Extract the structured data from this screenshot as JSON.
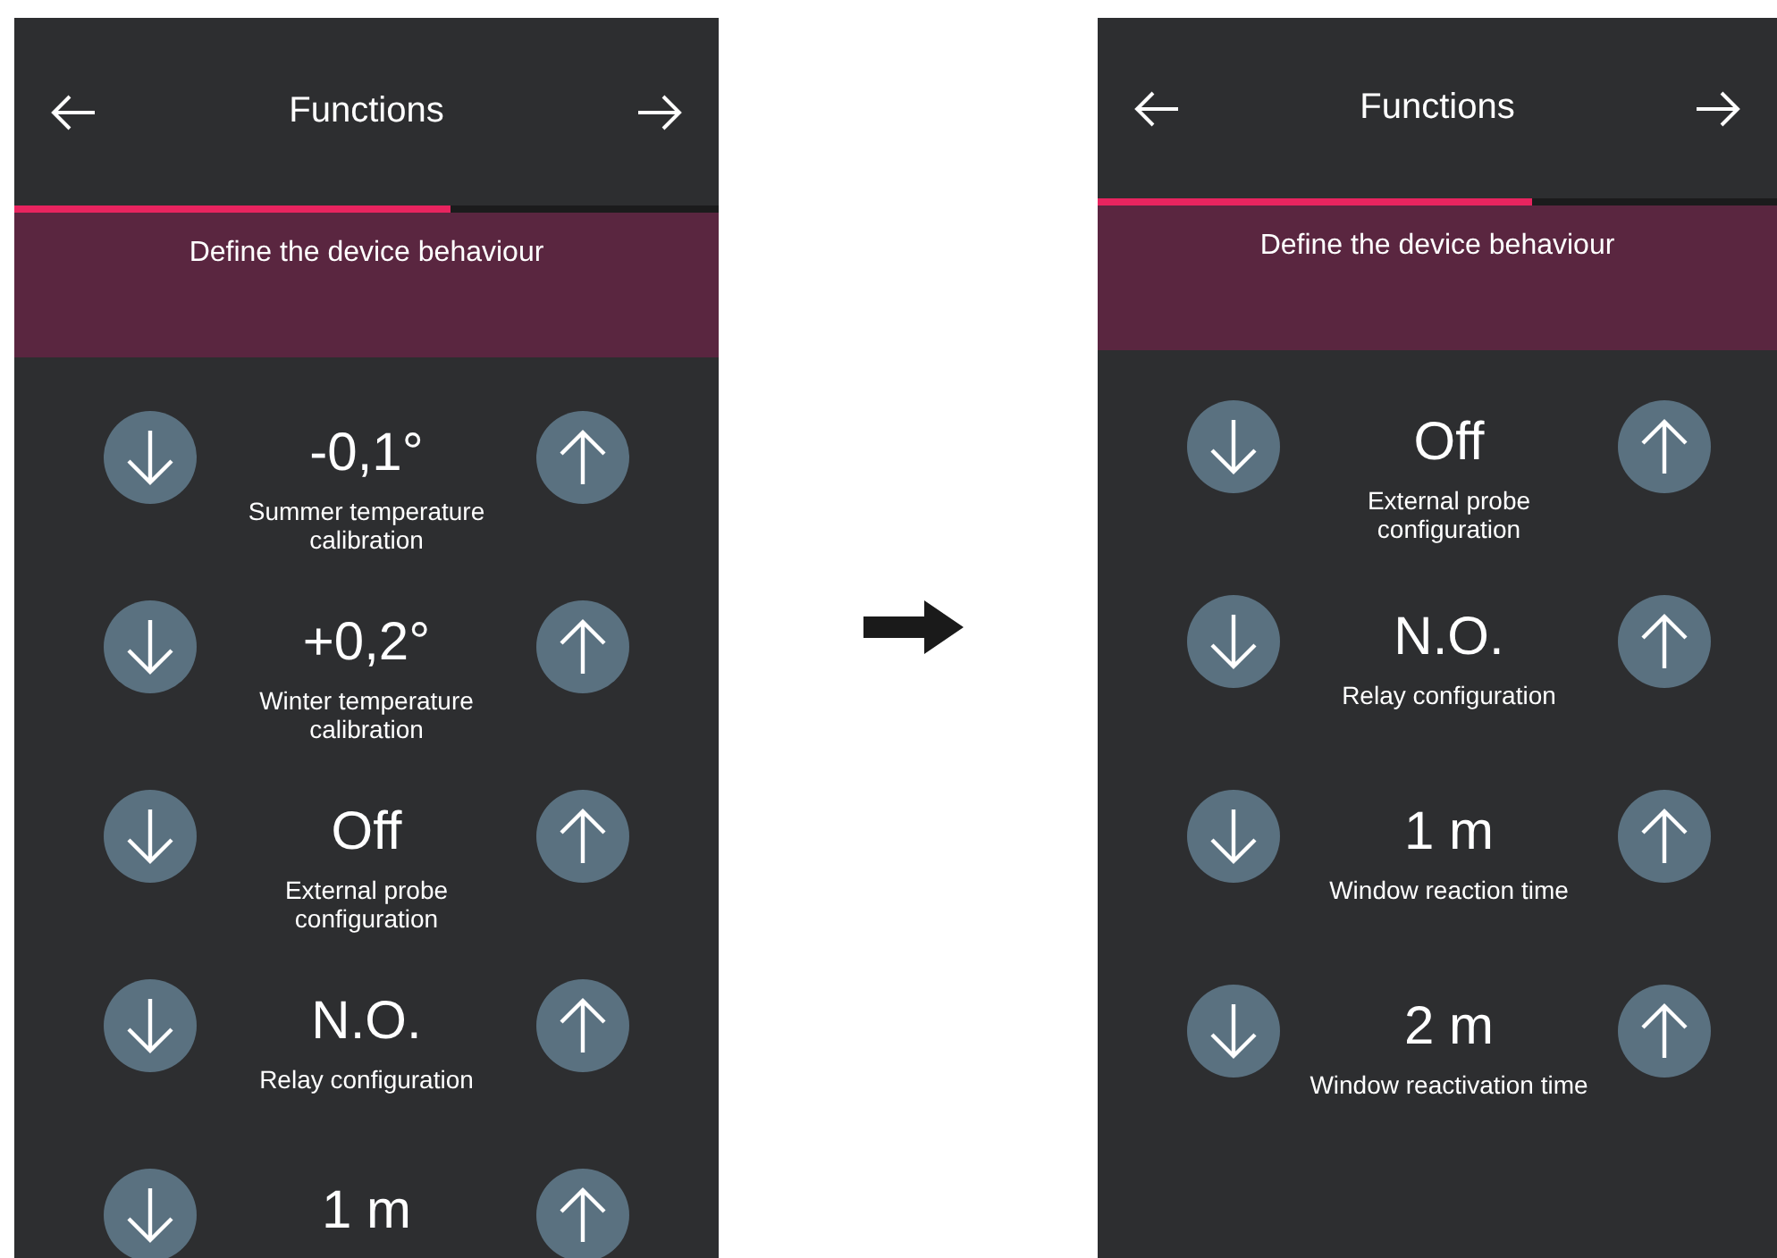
{
  "screens": [
    {
      "title": "Functions",
      "progress": {
        "level": 0.62
      },
      "subtitle": "Define the device behaviour",
      "settings": [
        {
          "value": "-0,1°",
          "label": "Summer temperature calibration"
        },
        {
          "value": "+0,2°",
          "label": "Winter temperature calibration"
        },
        {
          "value": "Off",
          "label": "External probe configuration"
        },
        {
          "value": "N.O.",
          "label": "Relay configuration"
        },
        {
          "value": "1 m"
        }
      ]
    },
    {
      "title": "Functions",
      "progress": {
        "level": 0.64
      },
      "subtitle": "Define the device behaviour",
      "settings": [
        {
          "value": "Off",
          "label": "External probe configuration"
        },
        {
          "value": "N.O.",
          "label": "Relay configuration"
        },
        {
          "value": "1 m",
          "label": "Window reaction time"
        },
        {
          "value": "2 m",
          "label": "Window reactivation time"
        }
      ]
    }
  ]
}
